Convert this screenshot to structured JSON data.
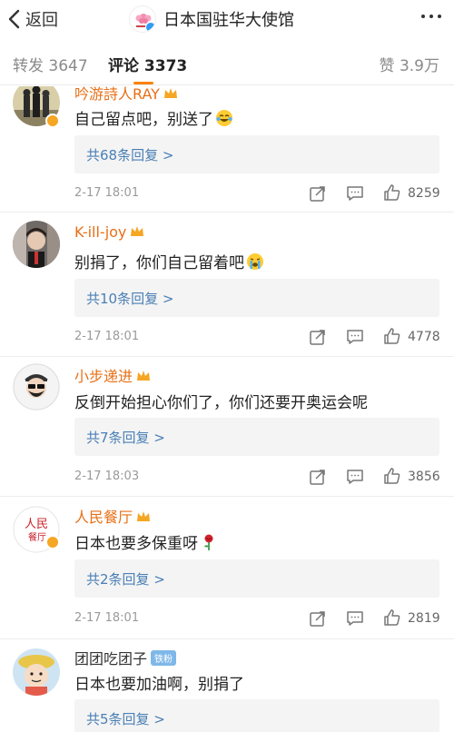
{
  "nav": {
    "back_label": "返回",
    "title": "日本国驻华大使馆"
  },
  "tabs": {
    "repost": "转发 3647",
    "comments": "评论 3373",
    "likes": "赞 3.9万"
  },
  "comments": [
    {
      "user": "吟游詩人RAY",
      "text": "自己留点吧，别送了",
      "emoji": "crying-laughing-emoji",
      "replies": "共68条回复 >",
      "time": "2-17 18:01",
      "likes": "8259"
    },
    {
      "user": "K-ill-joy",
      "text": "别捐了，你们自己留着吧",
      "emoji": "loudly-crying-emoji",
      "replies": "共10条回复 >",
      "time": "2-17 18:01",
      "likes": "4778"
    },
    {
      "user": "小步递进",
      "text": "反倒开始担心你们了，你们还要开奥运会呢",
      "replies": "共7条回复 >",
      "time": "2-17 18:03",
      "likes": "3856"
    },
    {
      "user": "人民餐厅",
      "text": "日本也要多保重呀",
      "emoji": "rose-emoji",
      "replies": "共2条回复 >",
      "time": "2-17 18:01",
      "likes": "2819"
    },
    {
      "user": "团团吃团子",
      "fan_badge": "铁粉",
      "text": "日本也要加油啊，别捐了",
      "replies": "共5条回复 >"
    }
  ],
  "avatar_text": {
    "people_restaurant_top": "人民",
    "people_restaurant_bottom": "餐厅"
  },
  "colors": {
    "accent": "#ff8200",
    "username": "#e86f17",
    "reply_link": "#4a7fb5",
    "verified_blue": "#2e9cf5",
    "verified_yellow": "#f5a623"
  }
}
